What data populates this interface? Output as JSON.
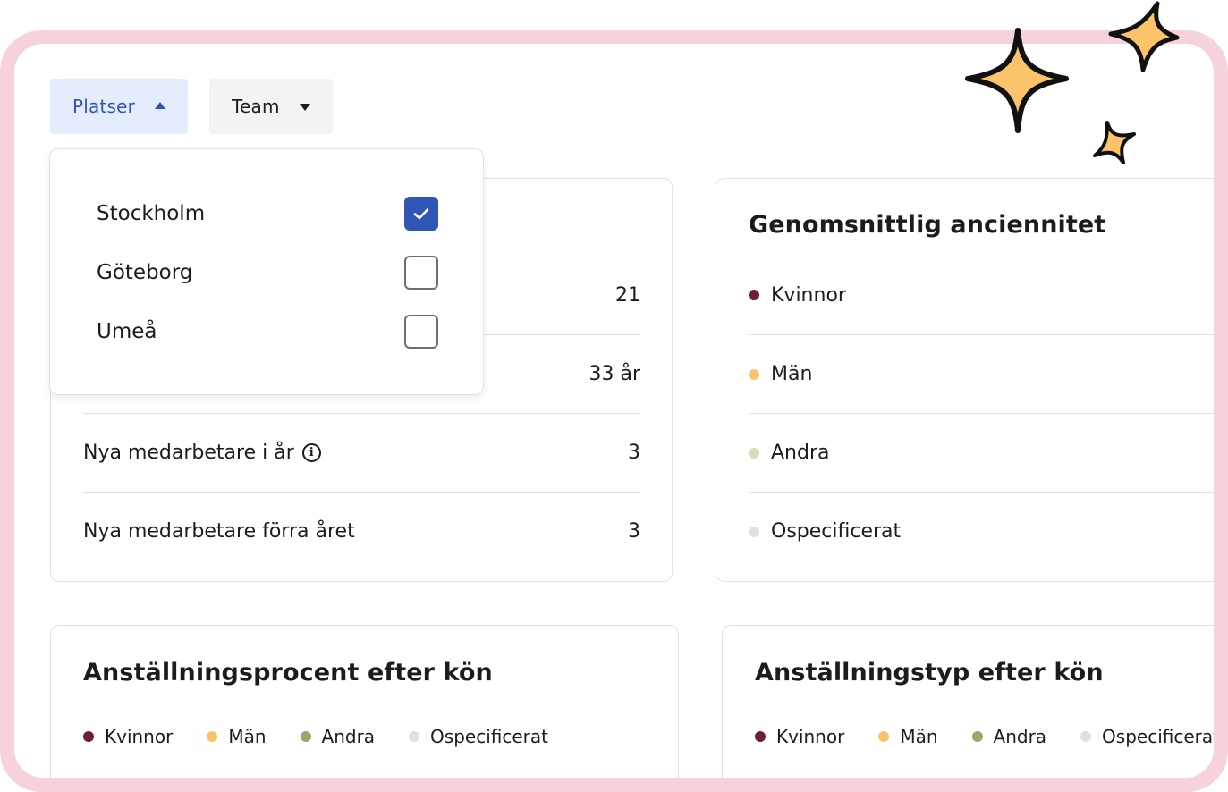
{
  "filters": {
    "platser_label": "Platser",
    "team_label": "Team"
  },
  "dropdown": {
    "options": [
      {
        "label": "Stockholm",
        "checked": true
      },
      {
        "label": "Göteborg",
        "checked": false
      },
      {
        "label": "Umeå",
        "checked": false
      }
    ]
  },
  "stats_card": {
    "rows": [
      {
        "label": "",
        "value": "21"
      },
      {
        "label": "",
        "value": "33 år"
      },
      {
        "label": "Nya medarbetare i år",
        "value": "3"
      },
      {
        "label": "Nya medarbetare förra året",
        "value": "3"
      }
    ]
  },
  "seniority_card": {
    "title": "Genomsnittlig anciennitet",
    "rows": [
      {
        "label": "Kvinnor"
      },
      {
        "label": "Män"
      },
      {
        "label": "Andra"
      },
      {
        "label": "Ospecificerat"
      }
    ]
  },
  "employment_percent_card": {
    "title": "Anställningsprocent efter kön",
    "legend": [
      "Kvinnor",
      "Män",
      "Andra",
      "Ospecificerat"
    ]
  },
  "employment_type_card": {
    "title": "Anställningstyp efter kön",
    "legend": [
      "Kvinnor",
      "Män",
      "Andra",
      "Ospecificerat"
    ]
  },
  "colors": {
    "frame": "#f6d3da",
    "accent": "#2f56b5",
    "accent_bg": "#e4ecfd",
    "kvinnor": "#6f1d3b",
    "man": "#fbc46a",
    "andra": "#97a86a",
    "andra_light": "#d5dcbc",
    "ospecificerat": "#e0e0e0",
    "sparkle": "#fbc46a"
  },
  "icons": {
    "checkbox_check": "check-icon",
    "info": "info-icon",
    "sparkles": "sparkle-icon"
  }
}
